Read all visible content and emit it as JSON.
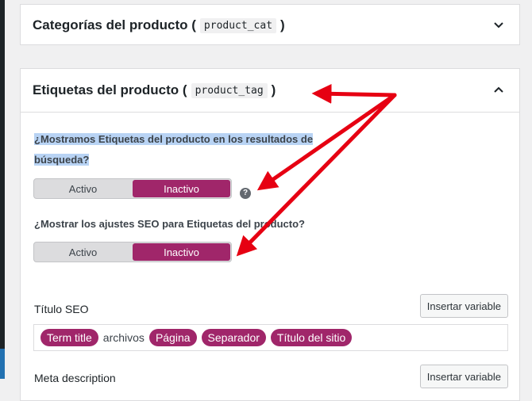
{
  "panels": {
    "categories": {
      "title": "Categorías del producto (",
      "code": "product_cat",
      "close": ")"
    },
    "tags": {
      "title": "Etiquetas del producto (",
      "code": "product_tag",
      "close": ")"
    }
  },
  "settings": {
    "show_in_search": {
      "question_line1": "¿Mostramos Etiquetas del producto en los resultados de",
      "question_line2": "búsqueda?",
      "option_on": "Activo",
      "option_off": "Inactivo",
      "selected": "Inactivo"
    },
    "show_seo": {
      "question": "¿Mostrar los ajustes SEO para Etiquetas del producto?",
      "option_on": "Activo",
      "option_off": "Inactivo",
      "selected": "Inactivo"
    }
  },
  "seo_title": {
    "label": "Título SEO",
    "insert_button": "Insertar variable",
    "tokens": [
      "Term title",
      "archivos",
      "Página",
      "Separador",
      "Título del sitio"
    ]
  },
  "meta_description": {
    "label": "Meta description",
    "insert_button": "Insertar variable"
  },
  "icons": {
    "help": "question-mark-icon",
    "chevron_down": "chevron-down-icon",
    "chevron_up": "chevron-up-icon"
  },
  "colors": {
    "accent": "#a0266a",
    "highlight": "#b8d3f4",
    "annotation": "#e60012"
  }
}
